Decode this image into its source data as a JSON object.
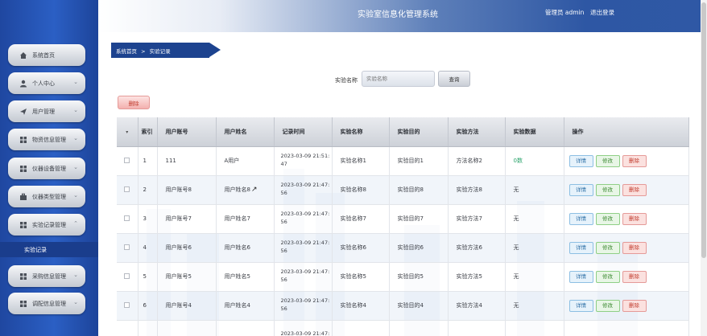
{
  "header": {
    "title": "实验室信息化管理系统",
    "user": "管理员 admin",
    "logout": "退出登录"
  },
  "sidebar": {
    "items": [
      {
        "label": "系统首页",
        "icon": "home-icon",
        "has_chevron": false
      },
      {
        "label": "个人中心",
        "icon": "user-icon",
        "has_chevron": true
      },
      {
        "label": "用户管理",
        "icon": "send-icon",
        "has_chevron": true
      },
      {
        "label": "物资信息管理",
        "icon": "grid-icon",
        "has_chevron": true
      },
      {
        "label": "仪器设备管理",
        "icon": "grid-icon",
        "has_chevron": true
      },
      {
        "label": "仪器类型管理",
        "icon": "briefcase-icon",
        "has_chevron": true
      },
      {
        "label": "实验记录管理",
        "icon": "grid-icon",
        "has_chevron": true,
        "expanded": true
      },
      {
        "label": "采购信息管理",
        "icon": "grid-icon",
        "has_chevron": true
      },
      {
        "label": "调配信息管理",
        "icon": "grid-icon",
        "has_chevron": true
      }
    ],
    "sub_item": "实验记录"
  },
  "breadcrumb": {
    "home": "系统首页",
    "separator": ">",
    "current": "实验记录"
  },
  "search": {
    "label": "实验名称",
    "placeholder": "实验名称",
    "button": "查询"
  },
  "toolbar": {
    "delete_label": "删除"
  },
  "table": {
    "columns": [
      "",
      "索引",
      "用户账号",
      "用户姓名",
      "记录时间",
      "实验名称",
      "实验目的",
      "实验方法",
      "实验数据",
      "操作"
    ],
    "actions": {
      "detail": "详情",
      "edit": "修改",
      "delete": "删除"
    },
    "rows": [
      {
        "index": "1",
        "account": "111",
        "name": "A用户",
        "time_date": "2023-03-09 21:51:",
        "time_sec": "47",
        "exp_name": "实验名称1",
        "purpose": "实验目的1",
        "method": "方法名称2",
        "data": "0数"
      },
      {
        "index": "2",
        "account": "用户账号8",
        "name": "用户姓名8",
        "time_date": "2023-03-09 21:47:",
        "time_sec": "56",
        "exp_name": "实验名称8",
        "purpose": "实验目的8",
        "method": "实验方法8",
        "data": "无"
      },
      {
        "index": "3",
        "account": "用户账号7",
        "name": "用户姓名7",
        "time_date": "2023-03-09 21:47:",
        "time_sec": "56",
        "exp_name": "实验名称7",
        "purpose": "实验目的7",
        "method": "实验方法7",
        "data": "无"
      },
      {
        "index": "4",
        "account": "用户账号6",
        "name": "用户姓名6",
        "time_date": "2023-03-09 21:47:",
        "time_sec": "56",
        "exp_name": "实验名称6",
        "purpose": "实验目的6",
        "method": "实验方法6",
        "data": "无"
      },
      {
        "index": "5",
        "account": "用户账号5",
        "name": "用户姓名5",
        "time_date": "2023-03-09 21:47:",
        "time_sec": "56",
        "exp_name": "实验名称5",
        "purpose": "实验目的5",
        "method": "实验方法5",
        "data": "无"
      },
      {
        "index": "6",
        "account": "用户账号4",
        "name": "用户姓名4",
        "time_date": "2023-03-09 21:47:",
        "time_sec": "56",
        "exp_name": "实验名称4",
        "purpose": "实验目的4",
        "method": "实验方法4",
        "data": "无"
      },
      {
        "index": "",
        "account": "",
        "name": "",
        "time_date": "2023-03-09 21:47:",
        "time_sec": "",
        "exp_name": "",
        "purpose": "",
        "method": "",
        "data": ""
      }
    ]
  },
  "colors": {
    "sidebar": "#2b5fc4",
    "header_accent": "#2e57a4",
    "breadcrumb": "#1d438f",
    "delete": "#c0392b",
    "detail": "#2d6fa6",
    "edit": "#3d8a33"
  }
}
